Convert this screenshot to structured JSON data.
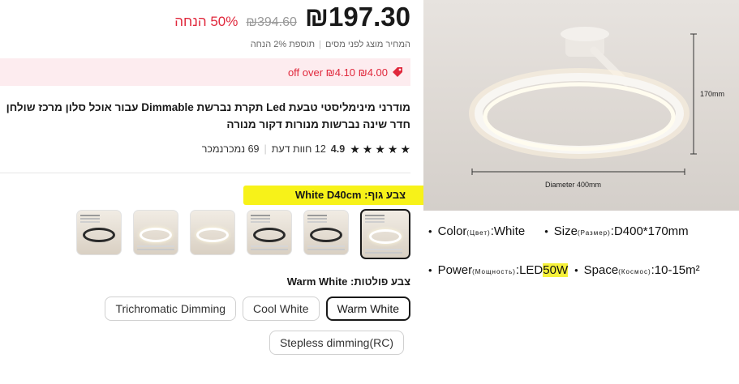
{
  "price": {
    "current": "₪197.30",
    "original": "₪394.60",
    "discount": "50% הנחה",
    "note_tax": "המחיר מוצג לפני מסים",
    "note_extra": "תוספת 2% הנחה"
  },
  "coupon": {
    "text": "₪4.00 off over ₪4.10",
    "icon": "tag-icon"
  },
  "product": {
    "title_line1": "מודרני מינימליסטי טבעת Led תקרת נברשת Dimmable עבור אוכל סלון מרכז שולחן",
    "title_line2": "חדר שינה נברשות מנורות דקור מנורה"
  },
  "rating": {
    "value": "4.9",
    "stars": 5,
    "reviews": "12 חוות דעת",
    "sold": "69 נמכרנמכר"
  },
  "body_color": {
    "label": "צבע גוף: White D40cm",
    "variants": 6,
    "selected_index": 0
  },
  "light_color": {
    "label": "צבע פולטות: Warm White",
    "options": [
      "Warm White",
      "Cool White",
      "Trichromatic Dimming",
      "Stepless dimming(RC)"
    ],
    "selected": "Warm White"
  },
  "image": {
    "height_label": "170mm",
    "diameter_label": "Diameter 400mm"
  },
  "specs": {
    "color_key": "Color",
    "color_ru": "(Цвет)",
    "color_val": ":White",
    "size_key": "Size",
    "size_ru": "(Размер)",
    "size_val": ":D400*170mm",
    "power_key": "Power",
    "power_ru": "(Мощность)",
    "power_val_a": ":LED",
    "power_val_b": "50W",
    "space_key": "Space",
    "space_ru": "(Космос)",
    "space_val": ":10-15m²",
    "bullet": "•"
  },
  "colors": {
    "accent_red": "#e0283c",
    "coupon_bg": "#fdecef",
    "highlight": "#f6f13a"
  }
}
